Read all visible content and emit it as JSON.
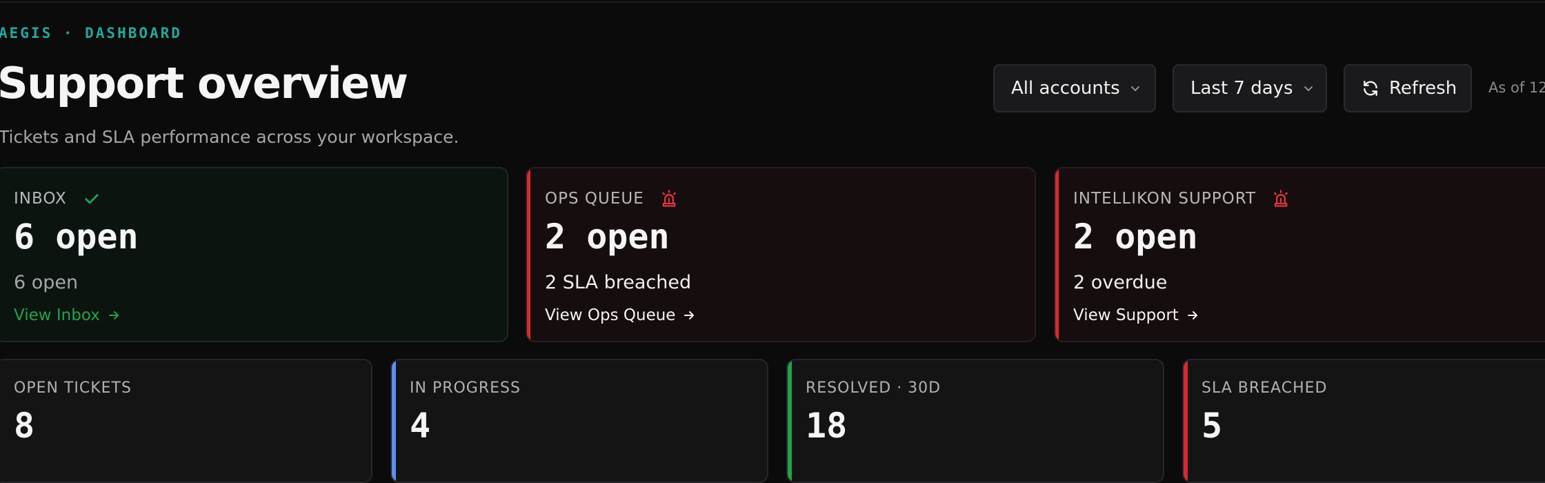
{
  "header": {
    "eyebrow": "AEGIS · DASHBOARD",
    "title": "Support overview",
    "subtitle": "Tickets and SLA performance across your workspace."
  },
  "controls": {
    "accounts_label": "All accounts",
    "range_label": "Last 7 days",
    "refresh_label": "Refresh",
    "as_of": "As of 12:"
  },
  "queues": [
    {
      "label": "INBOX",
      "status_icon": "check-icon",
      "value": "6 open",
      "sub": "6 open",
      "link": "View Inbox",
      "status": "ok"
    },
    {
      "label": "OPS QUEUE",
      "status_icon": "siren-icon",
      "value": "2 open",
      "sub": "2 SLA breached",
      "link": "View Ops Queue",
      "status": "alert"
    },
    {
      "label": "INTELLIKON SUPPORT",
      "status_icon": "siren-icon",
      "value": "2 open",
      "sub": "2 overdue",
      "link": "View Support",
      "status": "alert"
    }
  ],
  "stats": [
    {
      "label": "OPEN TICKETS",
      "value": "8",
      "accent": "#d96a1e"
    },
    {
      "label": "IN PROGRESS",
      "value": "4",
      "accent": "#5b8ff2"
    },
    {
      "label": "RESOLVED · 30D",
      "value": "18",
      "accent": "#22a34a"
    },
    {
      "label": "SLA BREACHED",
      "value": "5",
      "accent": "#d9292f"
    }
  ],
  "colors": {
    "brand": "#25a89e",
    "ok": "#22a34a",
    "alert": "#d9292f",
    "background": "#0b0b0c"
  }
}
